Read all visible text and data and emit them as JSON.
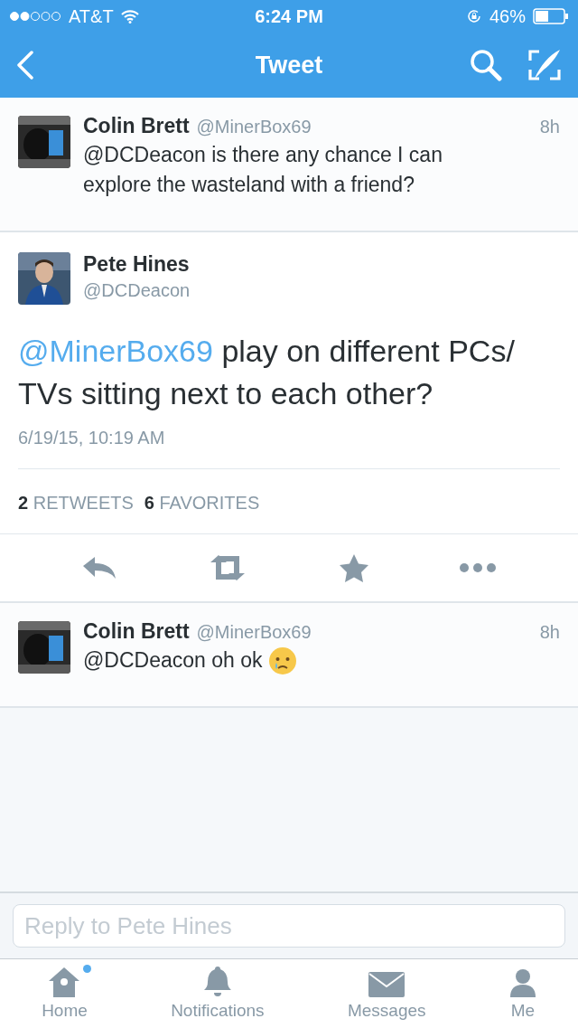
{
  "status_bar": {
    "carrier": "AT&T",
    "time": "6:24 PM",
    "battery": "46%"
  },
  "nav": {
    "title": "Tweet"
  },
  "tweets": [
    {
      "kind": "reply",
      "name": "Colin Brett",
      "handle": "@MinerBox69",
      "age": "8h",
      "text": "@DCDeacon is there any chance I can explore the wasteland with a friend?"
    },
    {
      "kind": "main",
      "name": "Pete Hines",
      "handle": "@DCDeacon",
      "mention": "@MinerBox69",
      "text": "play on different PCs/ TVs sitting next to each other?",
      "timestamp": "6/19/15, 10:19 AM",
      "retweets": "2",
      "retweets_label": "RETWEETS",
      "favorites": "6",
      "favorites_label": "FAVORITES"
    },
    {
      "kind": "reply_with_emoji",
      "name": "Colin Brett",
      "handle": "@MinerBox69",
      "age": "8h",
      "text": "@DCDeacon oh ok"
    }
  ],
  "reply_field": {
    "placeholder": "Reply to Pete Hines"
  },
  "tabs": [
    {
      "label": "Home",
      "kind": "home",
      "selected": false,
      "unread": true
    },
    {
      "label": "Notifications",
      "kind": "notifications",
      "selected": false,
      "unread": false
    },
    {
      "label": "Messages",
      "kind": "messages",
      "selected": false,
      "unread": false
    },
    {
      "label": "Me",
      "kind": "profile",
      "selected": false,
      "unread": false
    }
  ]
}
